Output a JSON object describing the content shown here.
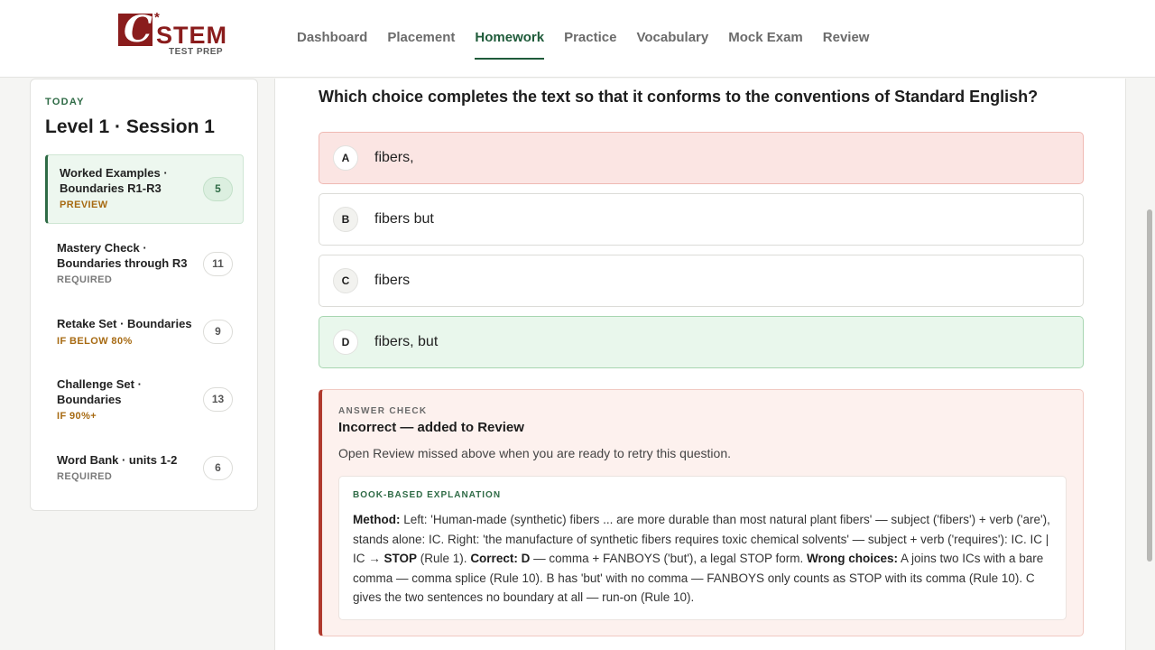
{
  "brand": {
    "mark": "C",
    "star": "*",
    "name": "STEM",
    "sub": "TEST PREP",
    "color": "#8a1c1c"
  },
  "nav": {
    "items": [
      {
        "label": "Dashboard",
        "active": false
      },
      {
        "label": "Placement",
        "active": false
      },
      {
        "label": "Homework",
        "active": true
      },
      {
        "label": "Practice",
        "active": false
      },
      {
        "label": "Vocabulary",
        "active": false
      },
      {
        "label": "Mock Exam",
        "active": false
      },
      {
        "label": "Review",
        "active": false
      }
    ],
    "accent": "#1f5b3a"
  },
  "sidebar": {
    "kicker": "TODAY",
    "title": "Level 1 · Session 1",
    "items": [
      {
        "label": "Worked Examples · Boundaries R1-R3",
        "status": "PREVIEW",
        "count": "5"
      },
      {
        "label": "Mastery Check · Boundaries through R3",
        "status": "REQUIRED",
        "count": "11"
      },
      {
        "label": "Retake Set · Boundaries",
        "status": "IF BELOW 80%",
        "count": "9"
      },
      {
        "label": "Challenge Set · Boundaries",
        "status": "IF 90%+",
        "count": "13"
      },
      {
        "label": "Word Bank · units 1-2",
        "status": "REQUIRED",
        "count": "6"
      }
    ]
  },
  "question": {
    "prompt": "Which choice completes the text so that it conforms to the conventions of Standard English?",
    "choices": [
      {
        "letter": "A",
        "text": "fibers,",
        "state": "selected-incorrect"
      },
      {
        "letter": "B",
        "text": "fibers but",
        "state": "neutral"
      },
      {
        "letter": "C",
        "text": "fibers",
        "state": "neutral"
      },
      {
        "letter": "D",
        "text": "fibers, but",
        "state": "correct"
      }
    ]
  },
  "answer_check": {
    "kicker": "ANSWER CHECK",
    "title": "Incorrect — added to Review",
    "note": "Open Review missed above when you are ready to retry this question.",
    "explanation": {
      "kicker": "BOOK-BASED EXPLANATION",
      "method_label": "Method:",
      "method_text": " Left: 'Human-made (synthetic) fibers ... are more durable than most natural plant fibers' — subject ('fibers') + verb ('are'), stands alone: IC. Right: 'the manufacture of synthetic fibers requires toxic chemical solvents' — subject + verb ('requires'): IC. IC | IC → ",
      "stop_label": "STOP",
      "rule1_text": " (Rule 1). ",
      "correct_label": "Correct: D",
      "correct_text": " — comma + FANBOYS ('but'), a legal STOP form. ",
      "wrong_label": "Wrong choices:",
      "wrong_text": " A joins two ICs with a bare comma — comma splice (Rule 10). B has 'but' with no comma — FANBOYS only counts as STOP with its comma (Rule 10). C gives the two sentences no boundary at all — run-on (Rule 10)."
    }
  },
  "colors": {
    "incorrect": "#b03a2e",
    "correct": "#2f6b46",
    "warning": "#a76a12"
  }
}
